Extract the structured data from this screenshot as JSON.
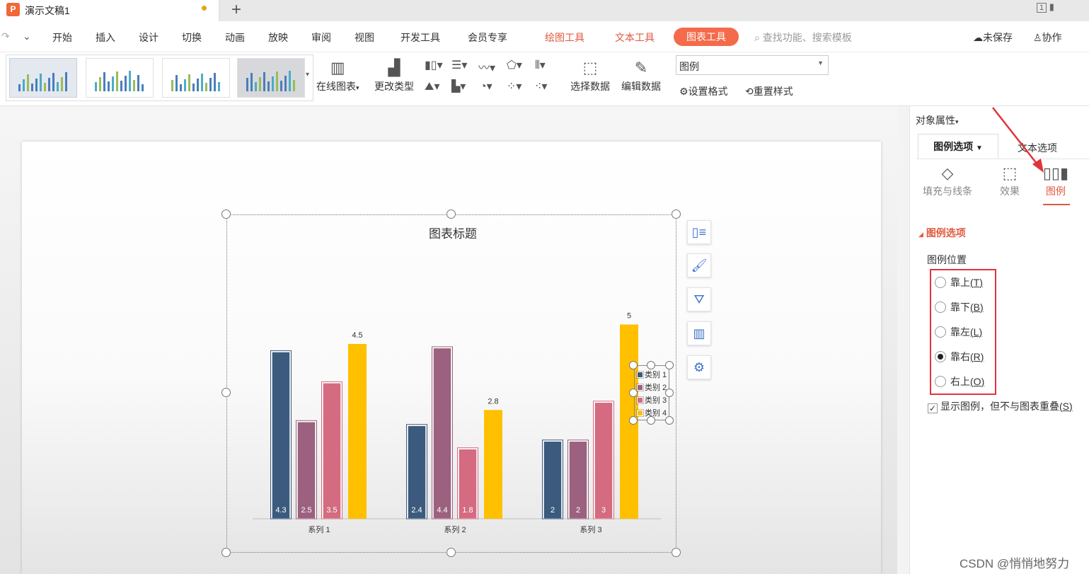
{
  "tabbar": {
    "doc_title": "演示文稿1",
    "logo": "P",
    "new_tab": "+",
    "window_icon": "1"
  },
  "menu": {
    "items": [
      "开始",
      "插入",
      "设计",
      "切换",
      "动画",
      "放映",
      "审阅",
      "视图",
      "开发工具",
      "会员专享"
    ],
    "context": [
      "绘图工具",
      "文本工具"
    ],
    "active": "图表工具",
    "search_placeholder": "查找功能、搜索模板",
    "save_state": "未保存",
    "collab": "协作"
  },
  "ribbon": {
    "online_chart": "在线图表",
    "change_type": "更改类型",
    "select_data": "选择数据",
    "edit_data": "编辑数据",
    "element_select": "图例",
    "set_format": "设置格式",
    "reset_style": "重置样式"
  },
  "chart_data": {
    "type": "bar",
    "title": "图表标题",
    "categories": [
      "系列 1",
      "系列 2",
      "系列 3"
    ],
    "series": [
      {
        "name": "类别 1",
        "color": "#3b5a7e",
        "values": [
          4.3,
          2.4,
          2
        ]
      },
      {
        "name": "类别 2",
        "color": "#9b617e",
        "values": [
          2.5,
          4.4,
          2
        ]
      },
      {
        "name": "类别 3",
        "color": "#d46b80",
        "values": [
          3.5,
          1.8,
          3
        ]
      },
      {
        "name": "类别 4",
        "color": "#ffc000",
        "values": [
          4.5,
          2.8,
          5
        ]
      }
    ],
    "ylim": [
      0,
      5.1
    ],
    "legend_position": "right",
    "gridlines": false
  },
  "panel": {
    "header": "对象属性",
    "tab_active": "图例选项",
    "tab_other": "文本选项",
    "icon_fill": "填充与线条",
    "icon_effect": "效果",
    "icon_legend": "图例",
    "section": "图例选项",
    "position_label": "图例位置",
    "radios": [
      {
        "label": "靠上",
        "key": "T",
        "checked": false
      },
      {
        "label": "靠下",
        "key": "B",
        "checked": false
      },
      {
        "label": "靠左",
        "key": "L",
        "checked": false
      },
      {
        "label": "靠右",
        "key": "R",
        "checked": true
      },
      {
        "label": "右上",
        "key": "O",
        "checked": false
      }
    ],
    "checkbox_label": "显示图例，但不与图表重叠",
    "checkbox_key": "S",
    "checkbox_checked": true
  },
  "watermark": "CSDN @悄悄地努力",
  "colors": {
    "accent": "#e0593f",
    "tab_active_bg": "#f56a4a",
    "annotation_red": "#e0343a"
  }
}
